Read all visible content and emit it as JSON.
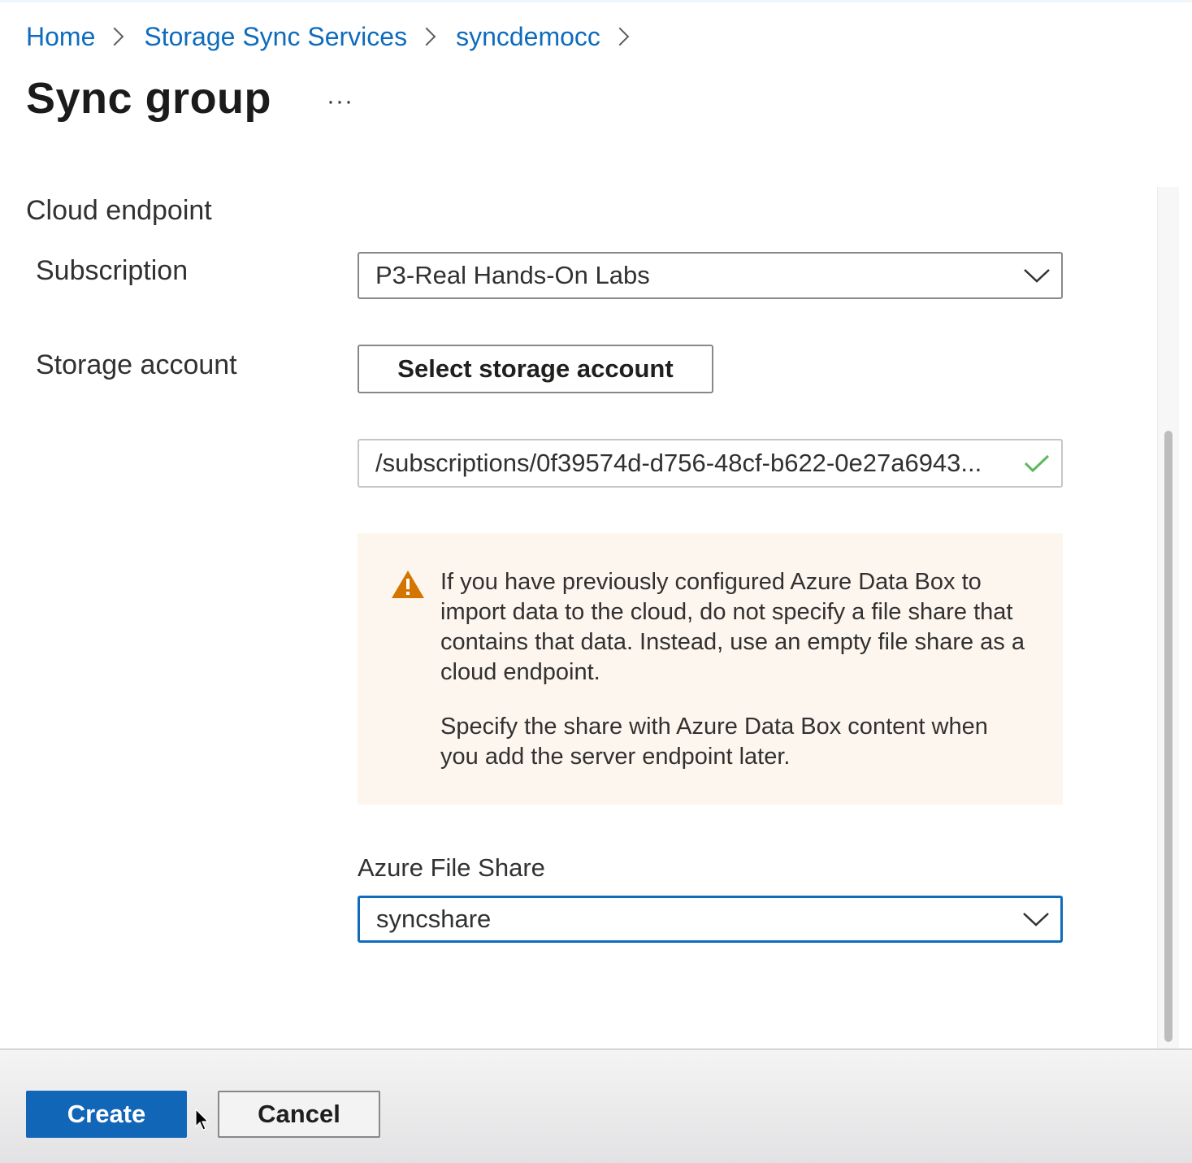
{
  "breadcrumb": {
    "items": [
      "Home",
      "Storage Sync Services",
      "syncdemocc"
    ]
  },
  "header": {
    "title": "Sync group",
    "more_label": "···"
  },
  "form": {
    "section_label": "Cloud endpoint",
    "subscription": {
      "label": "Subscription",
      "value": "P3-Real Hands-On Labs"
    },
    "storage_account": {
      "label": "Storage account",
      "select_button": "Select storage account",
      "value": "/subscriptions/0f39574d-d756-48cf-b622-0e27a6943..."
    },
    "warning": {
      "paragraph1": "If you have previously configured Azure Data Box to import data to the cloud, do not specify a file share that contains that data. Instead, use an empty file share as a cloud endpoint.",
      "paragraph2": "Specify the share with Azure Data Box content when you add the server endpoint later."
    },
    "file_share": {
      "label": "Azure File Share",
      "value": "syncshare"
    }
  },
  "footer": {
    "create_label": "Create",
    "cancel_label": "Cancel"
  },
  "colors": {
    "link": "#0f6cbd",
    "primary": "#1166b8",
    "warning_bg": "#fdf6ef",
    "warning_icon": "#d47500",
    "success": "#5cb85c"
  },
  "icons": {
    "chevron": "chevron-down-icon",
    "check": "checkmark-icon",
    "warning": "warning-triangle-icon",
    "separator": "chevron-right-icon"
  }
}
